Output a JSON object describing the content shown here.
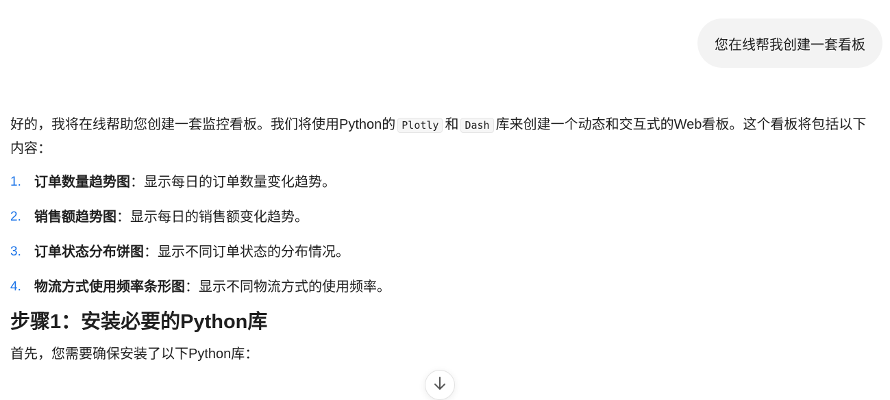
{
  "user_message": "您在线帮我创建一套看板",
  "reply": {
    "intro_before": "好的，我将在线帮助您创建一套监控看板。我们将使用Python的",
    "code1": "Plotly",
    "and": "和",
    "code2": "Dash",
    "intro_after": "库来创建一个动态和交互式的Web看板。这个看板将包括以下内容：",
    "items": [
      {
        "num": "1.",
        "title": "订单数量趋势图",
        "desc": "：显示每日的订单数量变化趋势。"
      },
      {
        "num": "2.",
        "title": "销售额趋势图",
        "desc": "：显示每日的销售额变化趋势。"
      },
      {
        "num": "3.",
        "title": "订单状态分布饼图",
        "desc": "：显示不同订单状态的分布情况。"
      },
      {
        "num": "4.",
        "title": "物流方式使用频率条形图",
        "desc": "：显示不同物流方式的使用频率。"
      }
    ],
    "step_heading": "步骤1：安装必要的Python库",
    "step_text": "首先，您需要确保安装了以下Python库："
  },
  "scroll_button_icon": "arrow-down-icon"
}
